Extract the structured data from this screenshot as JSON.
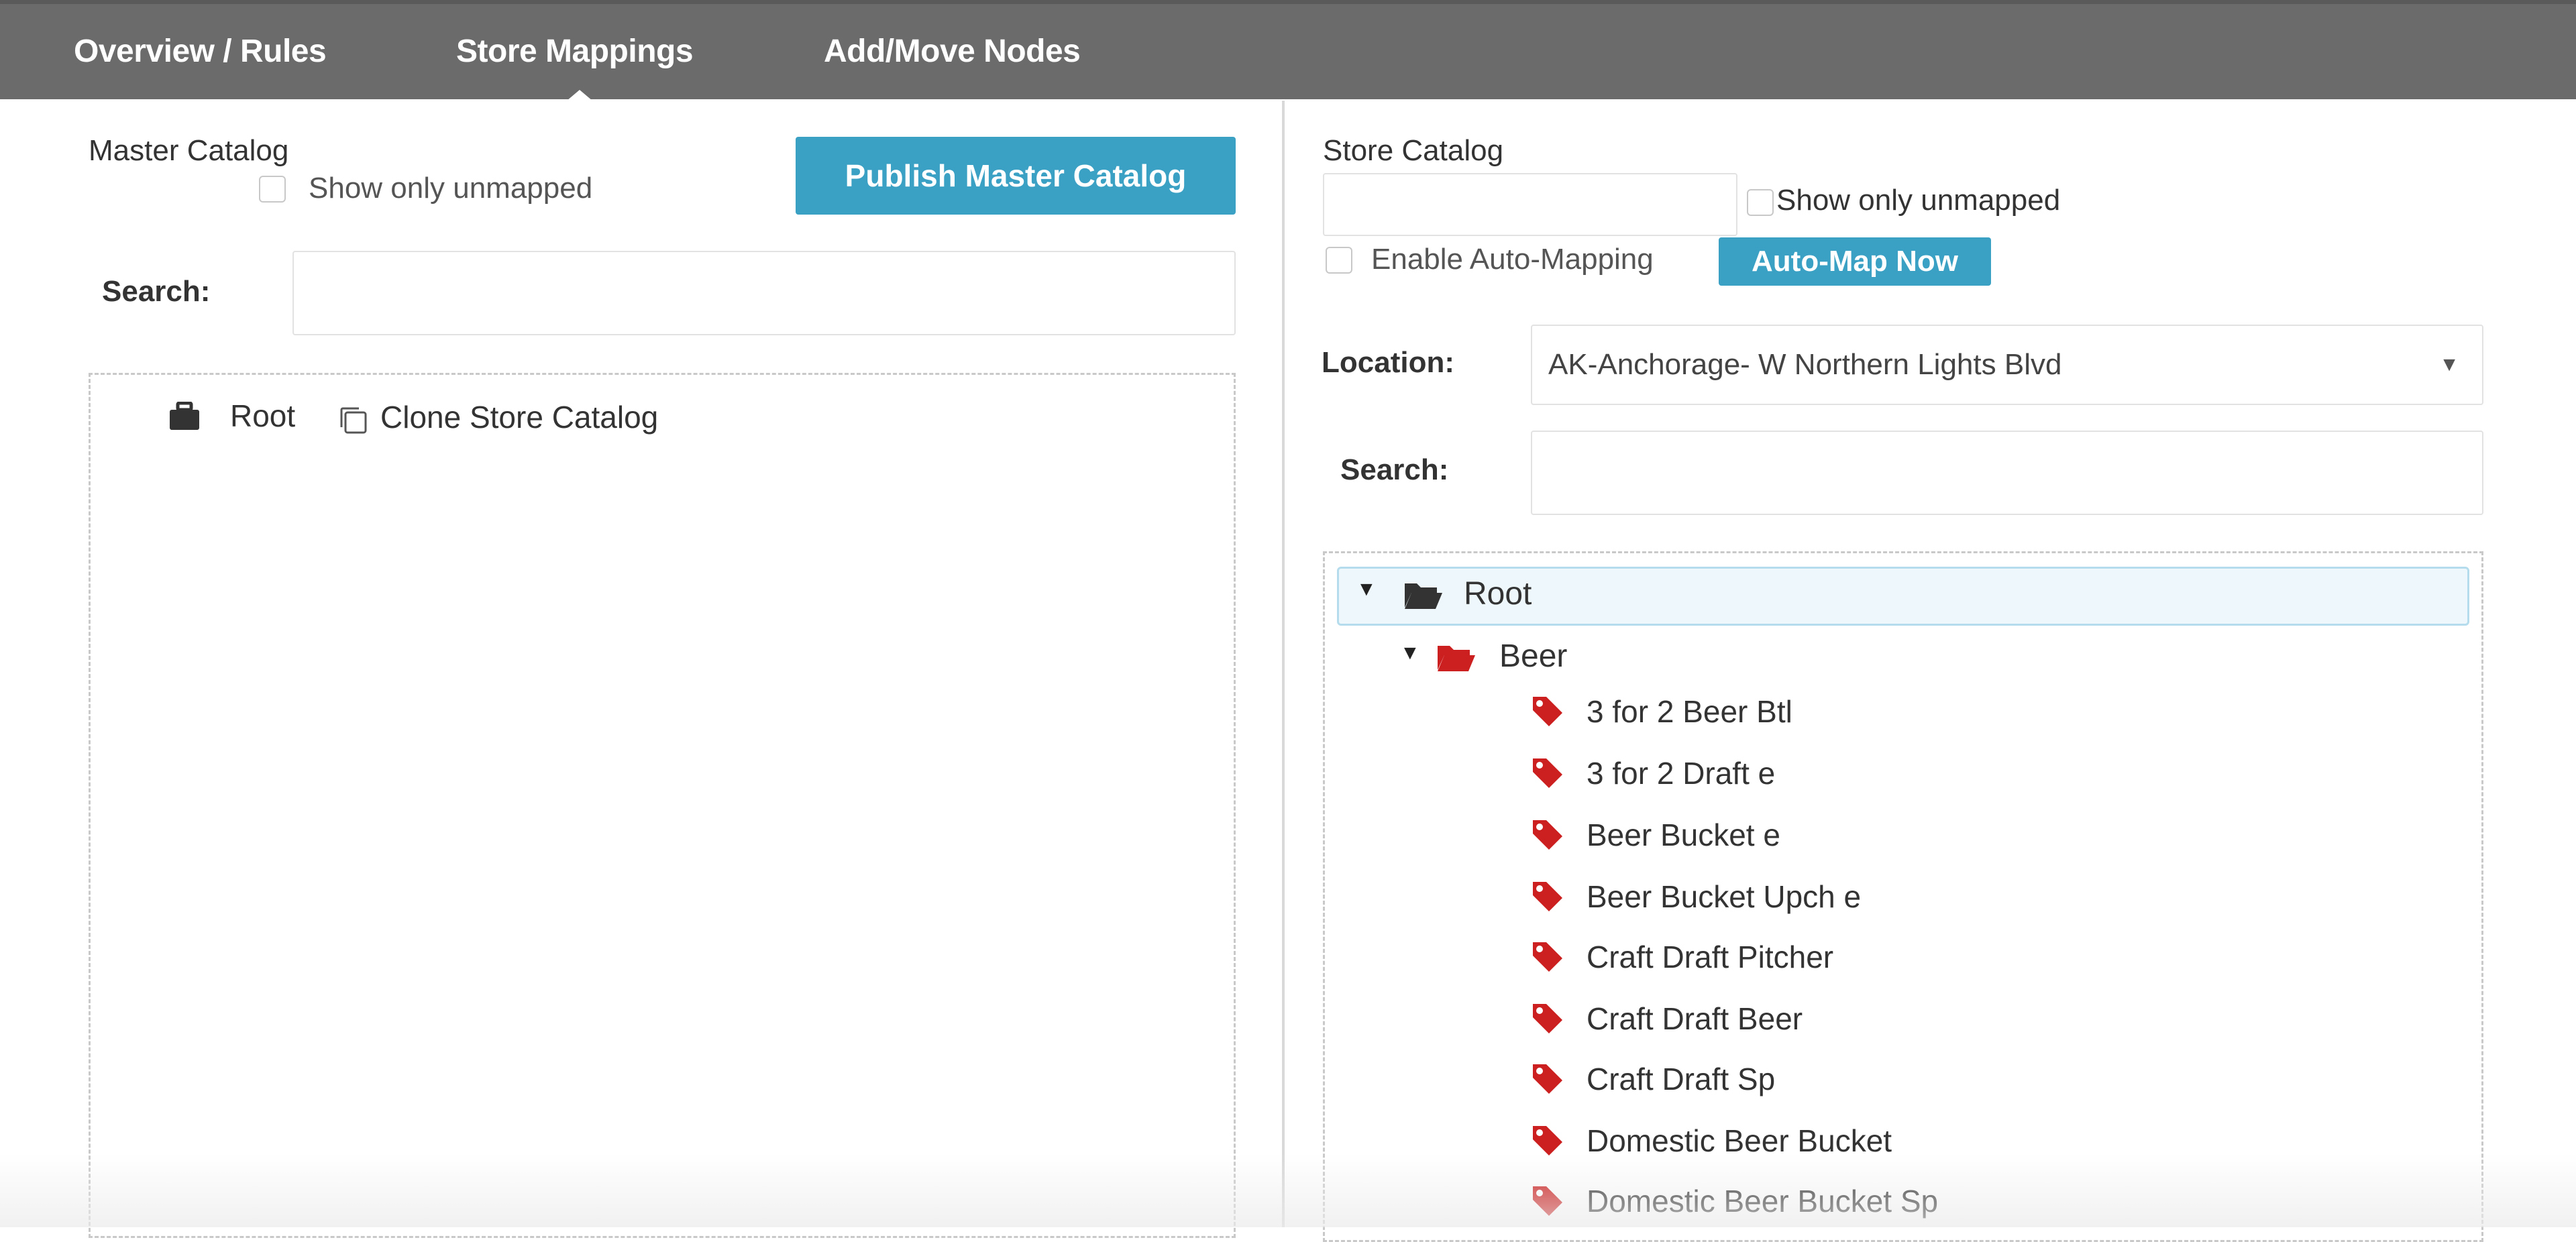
{
  "tabs": [
    {
      "label": "Overview / Rules"
    },
    {
      "label": "Store Mappings"
    },
    {
      "label": "Add/Move Nodes"
    }
  ],
  "master": {
    "title": "Master Catalog",
    "show_unmapped_label": "Show only unmapped",
    "publish_button": "Publish Master Catalog",
    "search_label": "Search:",
    "search_value": "",
    "tree_root": "Root",
    "clone_label": "Clone Store Catalog"
  },
  "store": {
    "title": "Store Catalog",
    "catalog_value": "",
    "show_unmapped_label": "Show only unmapped",
    "enable_automap_label": "Enable Auto-Mapping",
    "automap_button": "Auto-Map Now",
    "location_label": "Location:",
    "location_value": "AK-Anchorage- W Northern Lights Blvd",
    "search_label": "Search:",
    "search_value": "",
    "tree": {
      "root": "Root",
      "folder": "Beer",
      "items": [
        "3 for 2 Beer Btl",
        "3 for 2 Draft e",
        "Beer Bucket e",
        "Beer Bucket Upch e",
        "Craft Draft Pitcher",
        "Craft Draft Beer",
        "Craft Draft Sp",
        "Domestic Beer Bucket",
        "Domestic Beer Bucket Sp"
      ]
    }
  },
  "colors": {
    "topbar": "#6b6b6b",
    "button": "#3aa1c4",
    "tag": "#cc1f1f",
    "selected_row": "#eef8fc"
  }
}
